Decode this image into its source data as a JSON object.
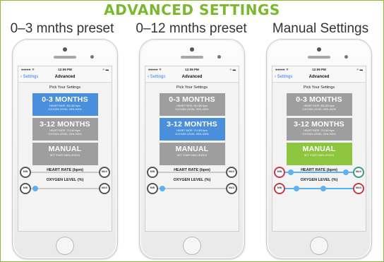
{
  "title": "ADVANCED SETTINGS",
  "columns": [
    {
      "label": "0–3 mnths preset",
      "status": {
        "time": "12:09 PM"
      },
      "nav": {
        "back": "Settings",
        "title": "Advanced"
      },
      "pick_label": "Pick Your Settings",
      "cards": [
        {
          "title": "0-3 MONTHS",
          "line1": "HEART RATE: 80-180 bpm",
          "line2": "OXYGEN LEVEL: 93%-100%",
          "style": "blue"
        },
        {
          "title": "3-12 MONTHS",
          "line1": "HEART RATE: 70-160 bpm",
          "line2": "OXYGEN LEVEL: 93%-100%",
          "style": "gray"
        },
        {
          "title": "MANUAL",
          "line1": "SET YOUR OWN LEVELS",
          "line2": "",
          "style": "gray"
        }
      ],
      "heart_label": "HEART RATE (bpm)",
      "oxygen_label": "OXYGEN LEVEL (%)",
      "heart": {
        "min": "MIN",
        "max": "MAX"
      },
      "oxygen": {
        "min": "MIN",
        "max": "MAX"
      }
    },
    {
      "label": "0–12 mnths preset",
      "status": {
        "time": "12:09 PM"
      },
      "nav": {
        "back": "Settings",
        "title": "Advanced"
      },
      "pick_label": "Pick Your Settings",
      "cards": [
        {
          "title": "0-3 MONTHS",
          "line1": "HEART RATE: 80-180 bpm",
          "line2": "OXYGEN LEVEL: 93%-100%",
          "style": "gray"
        },
        {
          "title": "3-12 MONTHS",
          "line1": "HEART RATE: 70-160 bpm",
          "line2": "OXYGEN LEVEL: 93%-100%",
          "style": "blue"
        },
        {
          "title": "MANUAL",
          "line1": "SET YOUR OWN LEVELS",
          "line2": "",
          "style": "gray"
        }
      ],
      "heart_label": "HEART RATE (bpm)",
      "oxygen_label": "OXYGEN LEVEL (%)",
      "heart": {
        "min": "MIN",
        "max": "MAX"
      },
      "oxygen": {
        "min": "MIN",
        "max": "MAX"
      }
    },
    {
      "label": "Manual Settings",
      "status": {
        "time": "12:09 PM"
      },
      "nav": {
        "back": "Settings",
        "title": "Advanced"
      },
      "pick_label": "Pick Your Settings",
      "cards": [
        {
          "title": "0-3 MONTHS",
          "line1": "HEART RATE: 80-180 bpm",
          "line2": "OXYGEN LEVEL: 93%-100%",
          "style": "gray"
        },
        {
          "title": "3-12 MONTHS",
          "line1": "HEART RATE: 70-160 bpm",
          "line2": "OXYGEN LEVEL: 93%-100%",
          "style": "gray"
        },
        {
          "title": "MANUAL",
          "line1": "SET YOUR OWN LEVELS",
          "line2": "",
          "style": "green"
        }
      ],
      "heart_label": "HEART RATE (bpm)",
      "oxygen_label": "OXYGEN LEVEL (%)",
      "heart": {
        "min": "MIN",
        "max": "MAX"
      },
      "oxygen": {
        "min": "MIN",
        "max": "MAX"
      }
    }
  ],
  "colors": {
    "title": "#7ab82e",
    "selected_card": "#4a8fdb",
    "manual_selected": "#8dc53f",
    "unselected_card": "#9e9e9e",
    "slider_active": "#5fb0f0"
  }
}
